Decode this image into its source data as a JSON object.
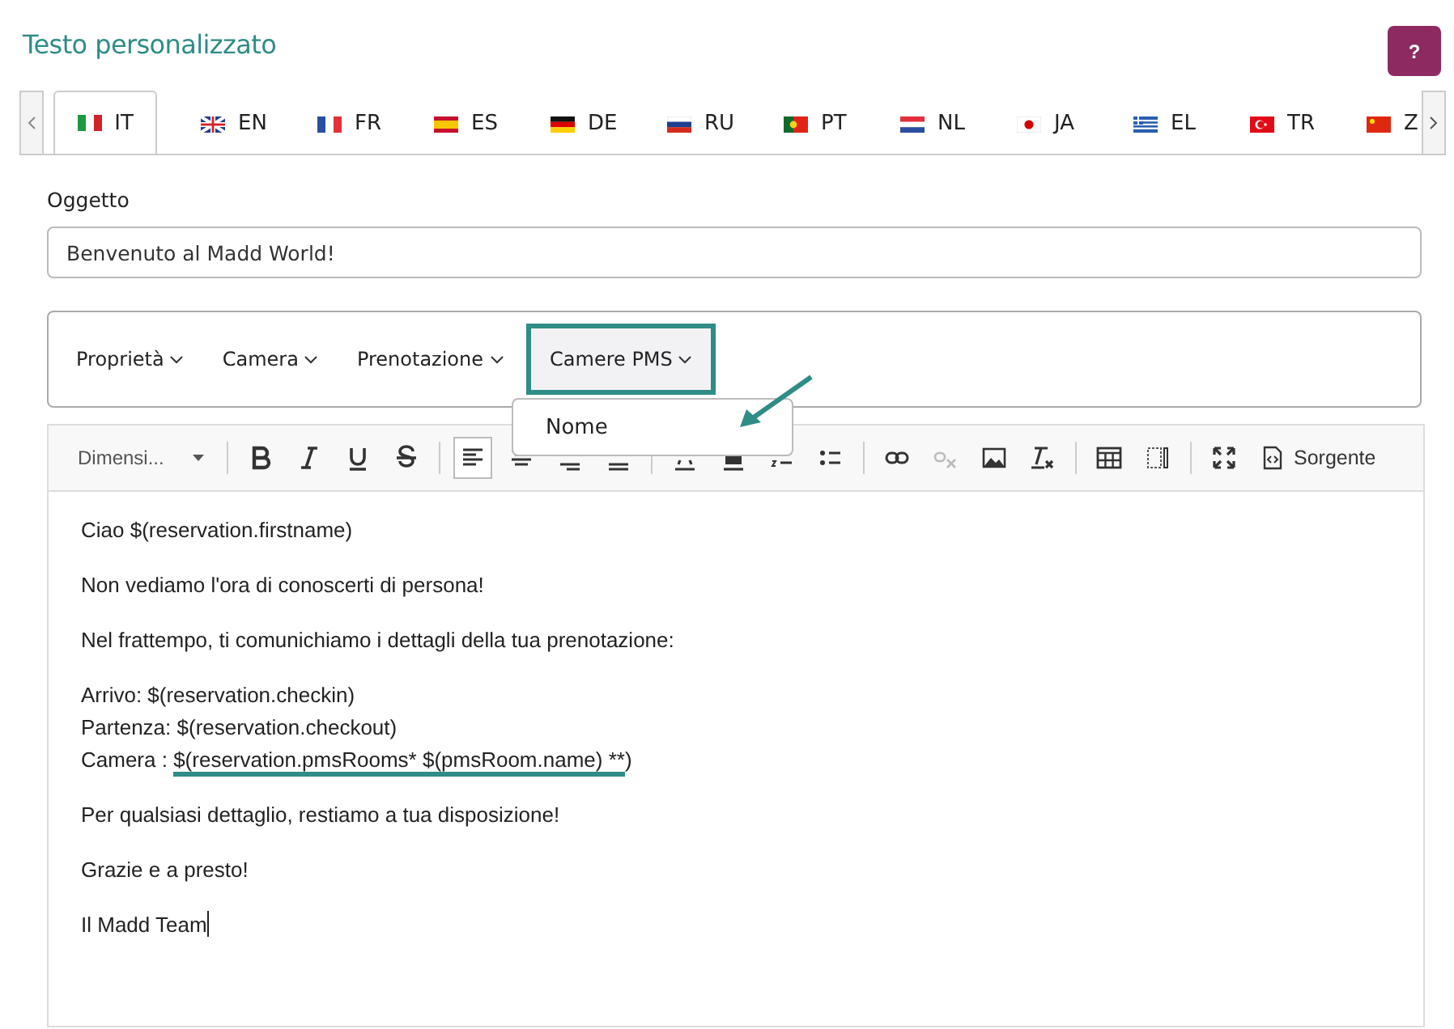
{
  "title": "Testo personalizzato",
  "help_button": "?",
  "tabs": [
    {
      "label": "IT",
      "selected": true
    },
    {
      "label": "EN",
      "selected": false
    },
    {
      "label": "FR",
      "selected": false
    },
    {
      "label": "ES",
      "selected": false
    },
    {
      "label": "DE",
      "selected": false
    },
    {
      "label": "RU",
      "selected": false
    },
    {
      "label": "PT",
      "selected": false
    },
    {
      "label": "NL",
      "selected": false
    },
    {
      "label": "JA",
      "selected": false
    },
    {
      "label": "EL",
      "selected": false
    },
    {
      "label": "TR",
      "selected": false
    },
    {
      "label": "Z",
      "selected": false
    }
  ],
  "subject": {
    "label": "Oggetto",
    "value": "Benvenuto al Madd World!"
  },
  "variables": [
    {
      "label": "Proprietà",
      "highlighted": false
    },
    {
      "label": "Camera",
      "highlighted": false
    },
    {
      "label": "Prenotazione",
      "highlighted": false
    },
    {
      "label": "Camere PMS",
      "highlighted": true
    }
  ],
  "variable_menu": {
    "items": [
      "Nome"
    ]
  },
  "toolbar": {
    "font_size": "Dimensi...",
    "source": "Sorgente"
  },
  "body": [
    {
      "lines": [
        {
          "text": "Ciao $(reservation.firstname)"
        }
      ]
    },
    {
      "lines": [
        {
          "text": "Non vediamo l'ora di conoscerti di persona!"
        }
      ]
    },
    {
      "lines": [
        {
          "text": "Nel frattempo, ti comunichiamo i dettagli della tua prenotazione:"
        }
      ]
    },
    {
      "lines": [
        {
          "text": "Arrivo: $(reservation.checkin)"
        },
        {
          "text": "Partenza: $(reservation.checkout)"
        },
        {
          "text": "Camera : ",
          "highlight": "$(reservation.pmsRooms* $(pmsRoom.name) **",
          "rest": ")"
        }
      ]
    },
    {
      "lines": [
        {
          "text": "Per qualsiasi dettaglio, restiamo a tua disposizione!"
        }
      ]
    },
    {
      "lines": [
        {
          "text": "Grazie e a presto!"
        }
      ]
    },
    {
      "lines": [
        {
          "text": "Il Madd Team"
        }
      ]
    }
  ]
}
